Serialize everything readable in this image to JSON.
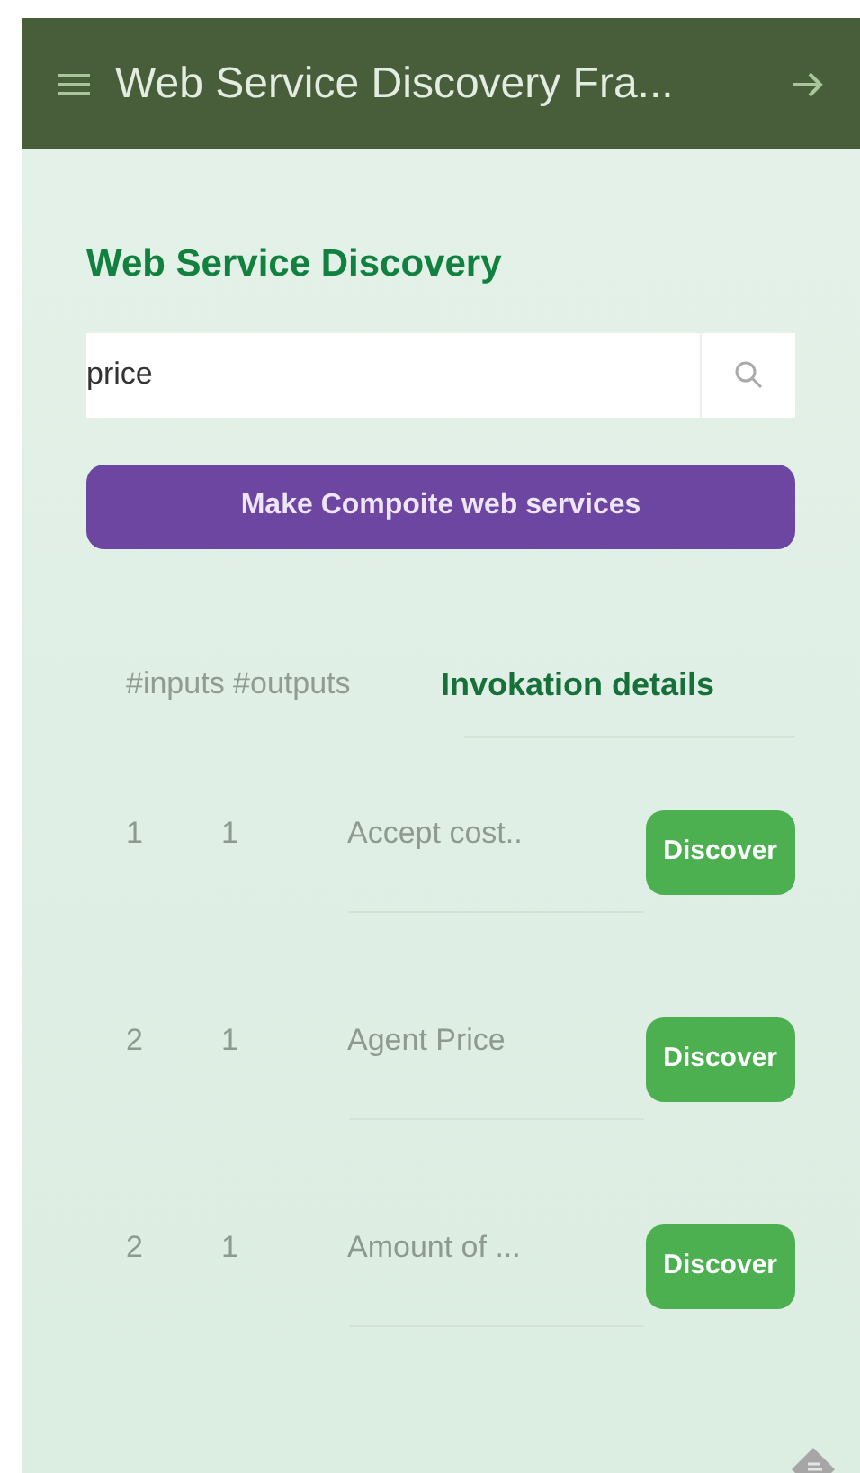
{
  "app_bar": {
    "title": "Web Service Discovery Fra..."
  },
  "heading": "Web Service Discovery",
  "search": {
    "value": "price"
  },
  "composite_button": "Make Compoite web services",
  "table": {
    "columns": [
      "#inputs #outputs",
      "Invokation details"
    ],
    "rows": [
      {
        "inputs": "1",
        "outputs": "1",
        "name": "Accept cost..",
        "action": "Discover"
      },
      {
        "inputs": "2",
        "outputs": "1",
        "name": "Agent Price",
        "action": "Discover"
      },
      {
        "inputs": "2",
        "outputs": "1",
        "name": "Amount of ...",
        "action": "Discover"
      }
    ]
  }
}
